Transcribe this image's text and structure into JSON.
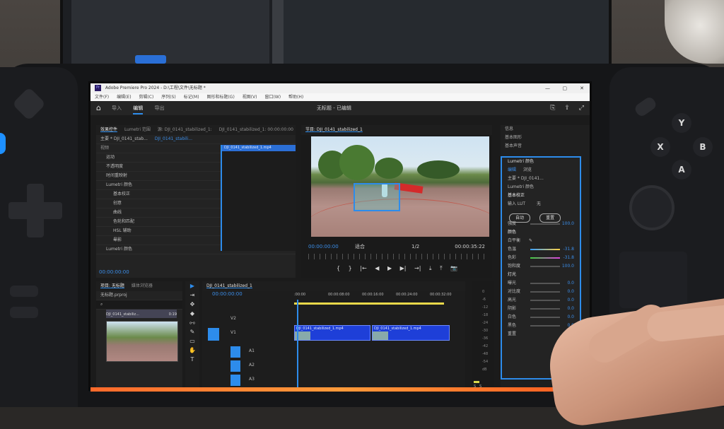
{
  "window": {
    "app_badge": "Pr",
    "title": "Adobe Premiere Pro 2024 - D:\\工程\\文件\\无标题 *",
    "controls": [
      "—",
      "▢",
      "✕"
    ]
  },
  "menu": [
    "文件(F)",
    "编辑(E)",
    "剪辑(C)",
    "序列(S)",
    "标记(M)",
    "图形和标题(G)",
    "视图(V)",
    "窗口(W)",
    "帮助(H)"
  ],
  "workspace": {
    "home_icon": "home-icon",
    "tabs": [
      {
        "label": "导入",
        "active": false
      },
      {
        "label": "编辑",
        "active": true
      },
      {
        "label": "导出",
        "active": false
      }
    ],
    "project_title": "无标题 - 已编辑",
    "icons": [
      "share-icon",
      "export-icon",
      "fullscreen-icon"
    ]
  },
  "effect_controls": {
    "tabs": [
      "效果控件",
      "Lumetri 范围",
      "源: DJI_0141_stabilized_1:",
      "DJI_0141_stabilized_1: 00:00:00:00"
    ],
    "source_label": "主要 * DJI_0141_stab...",
    "clip_label": "DJI_0141_stabili...",
    "clip_bar_label": "DJI_0141_stabilized_1.mp4",
    "section": "视频",
    "rows": [
      {
        "label": "运动"
      },
      {
        "label": "不透明度"
      },
      {
        "label": "时间重映射"
      },
      {
        "label": "Lumetri 颜色"
      },
      {
        "label": "基本校正"
      },
      {
        "label": "创意"
      },
      {
        "label": "曲线"
      },
      {
        "label": "色轮和匹配"
      },
      {
        "label": "HSL 辅助"
      },
      {
        "label": "晕影"
      },
      {
        "label": "Lumetri 颜色"
      }
    ],
    "timecode": "00:00:00:00"
  },
  "program_monitor": {
    "tab": "节目: DJI_0141_stabilized_1",
    "timecode": "00:00:00:00",
    "fit": "适合",
    "quality": "1/2",
    "duration": "00:00:35:22",
    "controls": [
      "{",
      "}",
      "|←",
      "◀",
      "▶",
      "▶|",
      "→|",
      "⤓",
      "⤒",
      "📷"
    ]
  },
  "lumetri_panel": {
    "header_items": [
      "信息",
      "基本图形",
      "基本声音"
    ],
    "tab": "Lumetri 颜色",
    "subtabs": [
      "编辑",
      "浏览"
    ],
    "clip": "主要 * DJI_0141...",
    "clip_effect": "Lumetri 颜色",
    "section": "基本校正",
    "lut_label": "输入 LUT",
    "lut_value": "无",
    "buttons": [
      "自动",
      "重置"
    ],
    "intensity_label": "强度",
    "intensity": "100.0",
    "color_section": "颜色",
    "white_balance": "白平衡",
    "color_rows": [
      {
        "label": "色温",
        "value": "-31.8"
      },
      {
        "label": "色彩",
        "value": "-31.8"
      },
      {
        "label": "饱和度",
        "value": "100.0"
      }
    ],
    "light_section": "灯光",
    "light_rows": [
      {
        "label": "曝光",
        "value": "0.0"
      },
      {
        "label": "对比度",
        "value": "0.0"
      },
      {
        "label": "高光",
        "value": "0.0"
      },
      {
        "label": "阴影",
        "value": "0.0"
      },
      {
        "label": "白色",
        "value": "0.0"
      },
      {
        "label": "黑色",
        "value": "0.0"
      }
    ],
    "footer": "重置"
  },
  "project_panel": {
    "tabs": [
      "项目: 无标题",
      "媒体浏览器"
    ],
    "file": "无标题.prproj",
    "search_placeholder": "",
    "item_name": "DJI_0141_stabiliz...",
    "item_duration": "0:19"
  },
  "tools": [
    "▶",
    "⇥",
    "✥",
    "◆",
    "⧟",
    "✎",
    "▭",
    "✋",
    "T"
  ],
  "timeline": {
    "tab": "DJI_0141_stabilized_1",
    "timecode": "00:00:00:00",
    "ruler": [
      ":00:00",
      "00:00:08:00",
      "00:00:16:00",
      "00:00:24:00",
      "00:00:32:00"
    ],
    "tracks": [
      {
        "name": "V2",
        "kind": "video"
      },
      {
        "name": "V1",
        "kind": "video"
      },
      {
        "name": "A1",
        "kind": "audio"
      },
      {
        "name": "A2",
        "kind": "audio"
      },
      {
        "name": "A3",
        "kind": "audio"
      }
    ],
    "clips": [
      {
        "label": "DJI_0141_stabilized_1.mp4"
      },
      {
        "label": "DJI_0141_stabilized_1.mp4"
      }
    ]
  },
  "audio_meter": {
    "ticks": [
      "0",
      "-6",
      "-12",
      "-18",
      "-24",
      "-30",
      "-36",
      "-42",
      "-48",
      "-54",
      "dB"
    ],
    "channels": [
      "S",
      "S"
    ]
  },
  "controller": {
    "face_buttons": [
      "Y",
      "X",
      "B",
      "A"
    ]
  },
  "colors": {
    "accent": "#2d8ceb",
    "clip": "#1e3fd8",
    "timecode": "#3b8eea",
    "workarea": "#e8d84a"
  }
}
